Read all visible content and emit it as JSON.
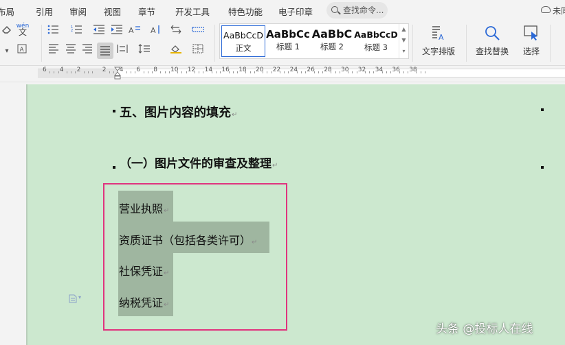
{
  "menu": {
    "tabs": [
      "布局",
      "引用",
      "审阅",
      "视图",
      "章节",
      "开发工具",
      "特色功能",
      "电子印章"
    ],
    "search_placeholder": "查找命令...",
    "sync_status": "未同"
  },
  "ribbon": {
    "styles": [
      {
        "preview": "AaBbCcD",
        "name": "正文"
      },
      {
        "preview": "AaBbCc",
        "name": "标题 1"
      },
      {
        "preview": "AaBbC",
        "name": "标题 2"
      },
      {
        "preview": "AaBbCcD",
        "name": "标题 3"
      }
    ],
    "text_layout_label": "文字排版",
    "find_replace_label": "查找替换",
    "select_label": "选择",
    "phonetic_label": "wén"
  },
  "ruler": {
    "numbers": [
      "6",
      "4",
      "2",
      "2",
      "4",
      "6",
      "8",
      "10",
      "12",
      "14",
      "16",
      "18",
      "20",
      "22",
      "24",
      "26",
      "28",
      "30",
      "32",
      "34",
      "36",
      "38"
    ]
  },
  "document": {
    "heading1": "五、图片内容的填充",
    "heading2": "（一）图片文件的审查及整理",
    "lines": [
      "营业执照",
      "资质证书（包括各类许可）",
      "社保凭证",
      "纳税凭证"
    ],
    "para_mark": "↵"
  },
  "watermark": "头条 @投标人在线",
  "colors": {
    "page_background": "#cce8cf",
    "selection": "#9fb6a0",
    "highlight_box": "#e0337e",
    "active_style_border": "#2a68d6"
  }
}
